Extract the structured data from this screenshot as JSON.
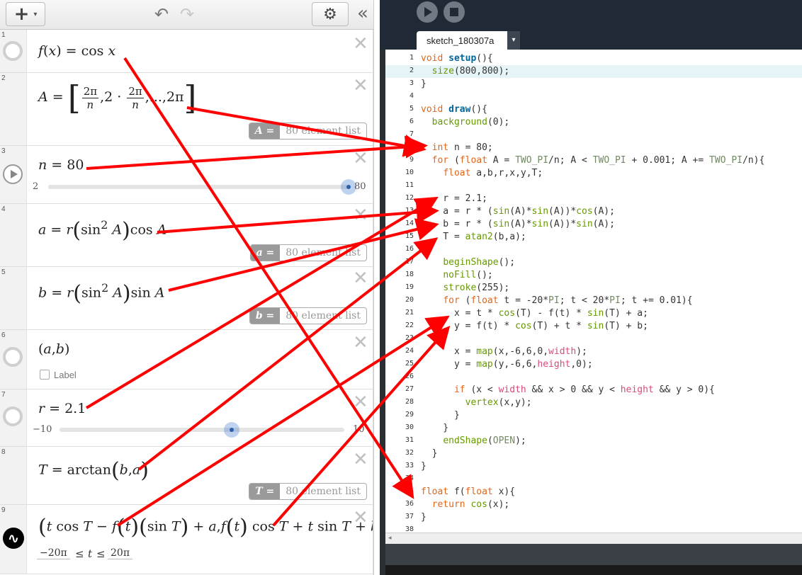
{
  "desmos": {
    "toolbar": {
      "add": "+",
      "add_caret": "▾",
      "undo": "↶",
      "redo": "↷",
      "settings": "⚙",
      "collapse": "«"
    },
    "rows": [
      {
        "num": "1"
      },
      {
        "num": "2",
        "list_var": "A =",
        "list_text": "80 element list"
      },
      {
        "num": "3",
        "slider_min": "2",
        "slider_max": "80",
        "slider_value": 80,
        "slider_range": [
          2,
          80
        ]
      },
      {
        "num": "4",
        "list_var": "a =",
        "list_text": "80 element list"
      },
      {
        "num": "5",
        "list_var": "b =",
        "list_text": "80 element list"
      },
      {
        "num": "6",
        "label": "Label"
      },
      {
        "num": "7",
        "slider_min": "−10",
        "slider_max": "10",
        "slider_value": 2.1,
        "slider_range": [
          -10,
          10
        ]
      },
      {
        "num": "8",
        "list_var": "T =",
        "list_text": "80 element list"
      },
      {
        "num": "9",
        "t_min": "−20π",
        "t_max": "20π",
        "leq": "≤",
        "tvar": "t"
      }
    ],
    "close": "✕"
  },
  "processing": {
    "tab": "sketch_180307a",
    "tab_menu": "▾",
    "code": [
      {
        "n": "1",
        "parts": [
          [
            "kw",
            "void "
          ],
          [
            "fn",
            "setup"
          ],
          [
            "",
            "(){"
          ]
        ]
      },
      {
        "n": "2",
        "hl": true,
        "parts": [
          [
            "",
            "  "
          ],
          [
            "bi",
            "size"
          ],
          [
            "",
            "(800,800);"
          ]
        ]
      },
      {
        "n": "3",
        "parts": [
          [
            "",
            "}"
          ]
        ]
      },
      {
        "n": "4",
        "parts": []
      },
      {
        "n": "5",
        "parts": [
          [
            "kw",
            "void "
          ],
          [
            "fn",
            "draw"
          ],
          [
            "",
            "(){"
          ]
        ]
      },
      {
        "n": "6",
        "parts": [
          [
            "",
            "  "
          ],
          [
            "bi",
            "background"
          ],
          [
            "",
            "(0);"
          ]
        ]
      },
      {
        "n": "7",
        "parts": []
      },
      {
        "n": "8",
        "parts": [
          [
            "",
            "  "
          ],
          [
            "kw",
            "int"
          ],
          [
            "",
            " n = 80;"
          ]
        ]
      },
      {
        "n": "9",
        "parts": [
          [
            "",
            "  "
          ],
          [
            "kw",
            "for"
          ],
          [
            "",
            " ("
          ],
          [
            "kw",
            "float"
          ],
          [
            "",
            " A = "
          ],
          [
            "ct",
            "TWO_PI"
          ],
          [
            "",
            "/n; A < "
          ],
          [
            "ct",
            "TWO_PI"
          ],
          [
            "",
            " + 0.001; A += "
          ],
          [
            "ct",
            "TWO_PI"
          ],
          [
            "",
            "/n){"
          ]
        ]
      },
      {
        "n": "10",
        "parts": [
          [
            "",
            "    "
          ],
          [
            "kw",
            "float"
          ],
          [
            "",
            " a,b,r,x,y,T;"
          ]
        ]
      },
      {
        "n": "11",
        "parts": []
      },
      {
        "n": "12",
        "parts": [
          [
            "",
            "    r = 2.1;"
          ]
        ]
      },
      {
        "n": "13",
        "parts": [
          [
            "",
            "    a = r * ("
          ],
          [
            "bi",
            "sin"
          ],
          [
            "",
            "(A)*"
          ],
          [
            "bi",
            "sin"
          ],
          [
            "",
            "(A))*"
          ],
          [
            "bi",
            "cos"
          ],
          [
            "",
            "(A);"
          ]
        ]
      },
      {
        "n": "14",
        "parts": [
          [
            "",
            "    b = r * ("
          ],
          [
            "bi",
            "sin"
          ],
          [
            "",
            "(A)*"
          ],
          [
            "bi",
            "sin"
          ],
          [
            "",
            "(A))*"
          ],
          [
            "bi",
            "sin"
          ],
          [
            "",
            "(A);"
          ]
        ]
      },
      {
        "n": "15",
        "parts": [
          [
            "",
            "    T = "
          ],
          [
            "bi",
            "atan2"
          ],
          [
            "",
            "(b,a);"
          ]
        ]
      },
      {
        "n": "16",
        "parts": []
      },
      {
        "n": "17",
        "parts": [
          [
            "",
            "    "
          ],
          [
            "bi",
            "beginShape"
          ],
          [
            "",
            "();"
          ]
        ]
      },
      {
        "n": "18",
        "parts": [
          [
            "",
            "    "
          ],
          [
            "bi",
            "noFill"
          ],
          [
            "",
            "();"
          ]
        ]
      },
      {
        "n": "19",
        "parts": [
          [
            "",
            "    "
          ],
          [
            "bi",
            "stroke"
          ],
          [
            "",
            "(255);"
          ]
        ]
      },
      {
        "n": "20",
        "parts": [
          [
            "",
            "    "
          ],
          [
            "kw",
            "for"
          ],
          [
            "",
            " ("
          ],
          [
            "kw",
            "float"
          ],
          [
            "",
            " t = -20*"
          ],
          [
            "ct",
            "PI"
          ],
          [
            "",
            "; t < 20*"
          ],
          [
            "ct",
            "PI"
          ],
          [
            "",
            "; t += 0.01){"
          ]
        ]
      },
      {
        "n": "21",
        "parts": [
          [
            "",
            "      x = t * "
          ],
          [
            "bi",
            "cos"
          ],
          [
            "",
            "(T) - f(t) * "
          ],
          [
            "bi",
            "sin"
          ],
          [
            "",
            "(T) + a;"
          ]
        ]
      },
      {
        "n": "22",
        "parts": [
          [
            "",
            "      y = f(t) * "
          ],
          [
            "bi",
            "cos"
          ],
          [
            "",
            "(T) + t * "
          ],
          [
            "bi",
            "sin"
          ],
          [
            "",
            "(T) + b;"
          ]
        ]
      },
      {
        "n": "23",
        "parts": []
      },
      {
        "n": "24",
        "parts": [
          [
            "",
            "      x = "
          ],
          [
            "bi",
            "map"
          ],
          [
            "",
            "(x,-6,6,0,"
          ],
          [
            "vr",
            "width"
          ],
          [
            "",
            ");"
          ]
        ]
      },
      {
        "n": "25",
        "parts": [
          [
            "",
            "      y = "
          ],
          [
            "bi",
            "map"
          ],
          [
            "",
            "(y,-6,6,"
          ],
          [
            "vr",
            "height"
          ],
          [
            "",
            ",0);"
          ]
        ]
      },
      {
        "n": "26",
        "parts": []
      },
      {
        "n": "27",
        "parts": [
          [
            "",
            "      "
          ],
          [
            "kw",
            "if"
          ],
          [
            "",
            " (x < "
          ],
          [
            "vr",
            "width"
          ],
          [
            "",
            " && x > 0 && y < "
          ],
          [
            "vr",
            "height"
          ],
          [
            "",
            " && y > 0){"
          ]
        ]
      },
      {
        "n": "28",
        "parts": [
          [
            "",
            "        "
          ],
          [
            "bi",
            "vertex"
          ],
          [
            "",
            "(x,y);"
          ]
        ]
      },
      {
        "n": "29",
        "parts": [
          [
            "",
            "      }"
          ]
        ]
      },
      {
        "n": "30",
        "parts": [
          [
            "",
            "    }"
          ]
        ]
      },
      {
        "n": "31",
        "parts": [
          [
            "",
            "    "
          ],
          [
            "bi",
            "endShape"
          ],
          [
            "",
            "("
          ],
          [
            "ct",
            "OPEN"
          ],
          [
            "",
            ");"
          ]
        ]
      },
      {
        "n": "32",
        "parts": [
          [
            "",
            "  }"
          ]
        ]
      },
      {
        "n": "33",
        "parts": [
          [
            "",
            "}"
          ]
        ]
      },
      {
        "n": "34",
        "parts": []
      },
      {
        "n": "35",
        "parts": [
          [
            "kw",
            "float"
          ],
          [
            "",
            " f("
          ],
          [
            "kw",
            "float"
          ],
          [
            "",
            " x){"
          ]
        ]
      },
      {
        "n": "36",
        "parts": [
          [
            "",
            "  "
          ],
          [
            "kw",
            "return"
          ],
          [
            "",
            " "
          ],
          [
            "bi",
            "cos"
          ],
          [
            "",
            "(x);"
          ]
        ]
      },
      {
        "n": "37",
        "parts": [
          [
            "",
            "}"
          ]
        ]
      },
      {
        "n": "38",
        "parts": []
      }
    ],
    "hscroll_arrow": "◂"
  },
  "colors": {
    "arrow": "#ff0000",
    "keyword": "#e2661a",
    "builtin": "#669900",
    "constant": "#718a62",
    "function": "#006699",
    "highlight": "#e6f4f8"
  }
}
